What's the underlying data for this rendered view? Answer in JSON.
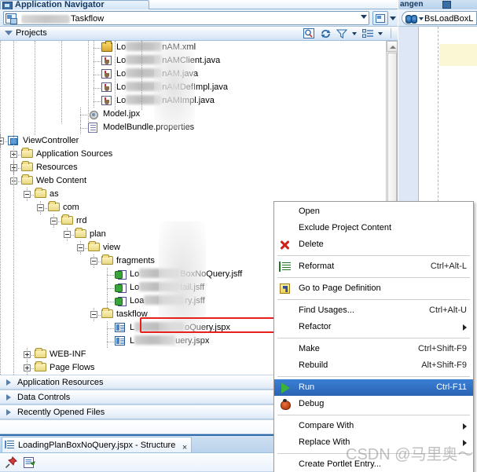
{
  "window": {
    "tab_title": "Application Navigator",
    "right_tab_title": "angen"
  },
  "navigator": {
    "combo_value": "Taskflow",
    "combo_blurred_prefix": true,
    "projects_label": "Projects",
    "toolbar_icons": [
      "search-icon",
      "refresh-icon",
      "filter-icon",
      "group-by-icon"
    ]
  },
  "tree": [
    {
      "indent": 7,
      "icon": "briefcase-icon",
      "blur_w": 46,
      "text_pre": "Lo",
      "text_post": "nAM.xml",
      "expander": "none"
    },
    {
      "indent": 7,
      "icon": "java-icon",
      "blur_w": 46,
      "text_pre": "Lo",
      "text_post": "nAMClient.java",
      "expander": "none"
    },
    {
      "indent": 7,
      "icon": "java-icon",
      "blur_w": 46,
      "text_pre": "Lo",
      "text_post": "nAM.java",
      "expander": "none"
    },
    {
      "indent": 7,
      "icon": "java-icon",
      "blur_w": 46,
      "text_pre": "Lo",
      "text_post": "nAMDefImpl.java",
      "expander": "none"
    },
    {
      "indent": 7,
      "icon": "java-icon",
      "blur_w": 46,
      "text_pre": "Lo",
      "text_post": "nAMImpl.java",
      "expander": "none"
    },
    {
      "indent": 6,
      "icon": "jpx-icon",
      "blur_w": 0,
      "text_pre": "",
      "text_post": "Model.jpx",
      "expander": "none"
    },
    {
      "indent": 6,
      "icon": "properties-icon",
      "blur_w": 0,
      "text_pre": "",
      "text_post": "ModelBundle.properties",
      "expander": "none"
    },
    {
      "indent": 0,
      "icon": "project-icon",
      "blur_w": 0,
      "text_pre": "",
      "text_post": "ViewController",
      "expander": "minus"
    },
    {
      "indent": 1,
      "icon": "folder-icon",
      "blur_w": 0,
      "text_pre": "",
      "text_post": "Application Sources",
      "expander": "plus"
    },
    {
      "indent": 1,
      "icon": "folder-icon",
      "blur_w": 0,
      "text_pre": "",
      "text_post": "Resources",
      "expander": "plus"
    },
    {
      "indent": 1,
      "icon": "folder-icon",
      "blur_w": 0,
      "text_pre": "",
      "text_post": "Web Content",
      "expander": "minus"
    },
    {
      "indent": 2,
      "icon": "folder-icon",
      "blur_w": 0,
      "text_pre": "",
      "text_post": "as",
      "expander": "minus"
    },
    {
      "indent": 3,
      "icon": "folder-icon",
      "blur_w": 0,
      "text_pre": "",
      "text_post": "com",
      "expander": "minus"
    },
    {
      "indent": 4,
      "icon": "folder-icon",
      "blur_w": 0,
      "text_pre": "",
      "text_post": "rrd",
      "expander": "minus"
    },
    {
      "indent": 5,
      "icon": "folder-icon",
      "blur_w": 0,
      "text_pre": "",
      "text_post": "plan",
      "expander": "minus"
    },
    {
      "indent": 6,
      "icon": "folder-icon",
      "blur_w": 0,
      "text_pre": "",
      "text_post": "view",
      "expander": "minus"
    },
    {
      "indent": 7,
      "icon": "folder-icon",
      "blur_w": 0,
      "text_pre": "",
      "text_post": "fragments",
      "expander": "minus"
    },
    {
      "indent": 8,
      "icon": "jsff-icon",
      "blur_w": 52,
      "text_pre": "Lo",
      "text_post": "BoxNoQuery.jsff",
      "expander": "none"
    },
    {
      "indent": 8,
      "icon": "jsff-icon",
      "blur_w": 52,
      "text_pre": "Lo",
      "text_post": "tail.jsff",
      "expander": "none"
    },
    {
      "indent": 8,
      "icon": "jsff-icon",
      "blur_w": 52,
      "text_pre": "Loa",
      "text_post": "ry.jsff",
      "expander": "none"
    },
    {
      "indent": 7,
      "icon": "folder-icon",
      "blur_w": 0,
      "text_pre": "",
      "text_post": "taskflow",
      "expander": "minus"
    },
    {
      "indent": 8,
      "icon": "jspx-icon",
      "blur_w": 64,
      "text_pre": "L",
      "text_post": "oQuery.jspx",
      "expander": "none",
      "selected": true
    },
    {
      "indent": 8,
      "icon": "jspx-icon",
      "blur_w": 52,
      "text_pre": "L",
      "text_post": "uery.jspx",
      "expander": "none"
    },
    {
      "indent": 2,
      "icon": "folder-icon",
      "blur_w": 0,
      "text_pre": "",
      "text_post": "WEB-INF",
      "expander": "plus"
    },
    {
      "indent": 2,
      "icon": "folder-icon",
      "blur_w": 0,
      "text_pre": "",
      "text_post": "Page Flows",
      "expander": "plus"
    }
  ],
  "collapsed_sections": [
    {
      "label": "Application Resources"
    },
    {
      "label": "Data Controls"
    },
    {
      "label": "Recently Opened Files"
    }
  ],
  "structure_panel": {
    "tab_label": "LoadingPlanBoxNoQuery.jspx - Structure",
    "close_label": "×",
    "toolbar_icons": [
      "pin-icon",
      "new-node-icon"
    ]
  },
  "editor": {
    "binocular_combo_value": "BsLoadBoxL"
  },
  "context_menu": {
    "items": [
      {
        "label": "Open",
        "shortcut": "",
        "icon": "none",
        "submenu": false,
        "selected": false
      },
      {
        "label": "Exclude Project Content",
        "shortcut": "",
        "icon": "none",
        "submenu": false,
        "selected": false
      },
      {
        "label": "Delete",
        "shortcut": "",
        "icon": "delete-icon",
        "submenu": false,
        "selected": false
      },
      {
        "type": "separator"
      },
      {
        "label": "Reformat",
        "shortcut": "Ctrl+Alt-L",
        "icon": "reformat-icon",
        "submenu": false,
        "selected": false
      },
      {
        "type": "separator"
      },
      {
        "label": "Go to Page Definition",
        "shortcut": "",
        "icon": "page-definition-icon",
        "submenu": false,
        "selected": false
      },
      {
        "type": "separator"
      },
      {
        "label": "Find Usages...",
        "shortcut": "Ctrl+Alt-U",
        "icon": "none",
        "submenu": false,
        "selected": false
      },
      {
        "label": "Refactor",
        "shortcut": "",
        "icon": "none",
        "submenu": true,
        "selected": false
      },
      {
        "type": "separator"
      },
      {
        "label": "Make",
        "shortcut": "Ctrl+Shift-F9",
        "icon": "none",
        "submenu": false,
        "selected": false
      },
      {
        "label": "Rebuild",
        "shortcut": "Alt+Shift-F9",
        "icon": "none",
        "submenu": false,
        "selected": false
      },
      {
        "type": "separator"
      },
      {
        "label": "Run",
        "shortcut": "Ctrl-F11",
        "icon": "run-icon",
        "submenu": false,
        "selected": true
      },
      {
        "label": "Debug",
        "shortcut": "",
        "icon": "debug-icon",
        "submenu": false,
        "selected": false
      },
      {
        "type": "separator"
      },
      {
        "label": "Compare With",
        "shortcut": "",
        "icon": "none",
        "submenu": true,
        "selected": false
      },
      {
        "label": "Replace With",
        "shortcut": "",
        "icon": "none",
        "submenu": true,
        "selected": false
      },
      {
        "type": "separator"
      },
      {
        "label": "Create Portlet Entry...",
        "shortcut": "",
        "icon": "none",
        "submenu": false,
        "selected": false
      }
    ]
  },
  "watermark": {
    "text": "CSDN @马里奥～"
  },
  "colors": {
    "selection_blue": "#2a63b2",
    "selection_outline_red": "#e8201b",
    "folder_yellow": "#e9d882",
    "highlight_yellow": "#faf7d4"
  }
}
